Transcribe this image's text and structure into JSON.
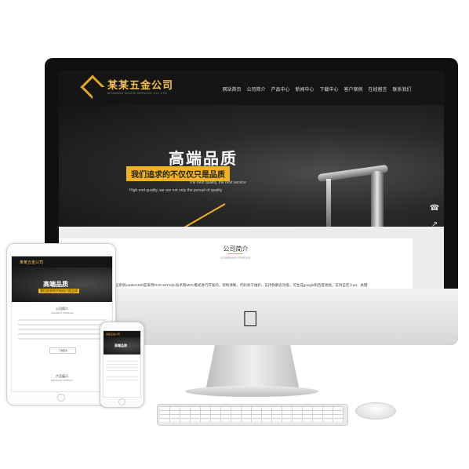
{
  "site": {
    "logo_text": "某某五金公司",
    "logo_sub": "MOUMOU WUJIN SERVICE CO.,LTD.",
    "nav": [
      "网站首页",
      "公司简介",
      "产品中心",
      "新闻中心",
      "下载中心",
      "客户案例",
      "在线留言",
      "联系我们"
    ]
  },
  "banner": {
    "title": "高端品质",
    "tagline": "我们追求的不仅仅只是品质",
    "en_line1": "The best quality, the best service",
    "en_line2": "High end quality, we are not only the pursuit of quality"
  },
  "side_icons": [
    "headset-icon",
    "share-icon",
    "qr-icon",
    "rocket-icon"
  ],
  "about": {
    "title": "公司简介",
    "en": "COMPANY PROFILE",
    "text": "这系统LankeCMS是采用PHP+MYSQL技术和MVC模式进行开发的，架构清晰，代码易于维护。支持伪静态功能，可生成google和百度地图，支持自定义url、关键"
  },
  "ipad": {
    "logo_text": "某某五金公司",
    "banner_title": "高端品质",
    "banner_tag": "我们追求的不仅仅只是品质",
    "about_title": "公司简介",
    "about_en": "COMPANY PROFILE",
    "more": "了解更多",
    "products_title": "产品展示",
    "products_en": "PRODUCT DISPLAY"
  },
  "iphone": {
    "logo_text": "某某五金公司",
    "banner_title": "高端品质"
  },
  "colors": {
    "accent": "#f0b21f",
    "header_bg": "#151515"
  }
}
